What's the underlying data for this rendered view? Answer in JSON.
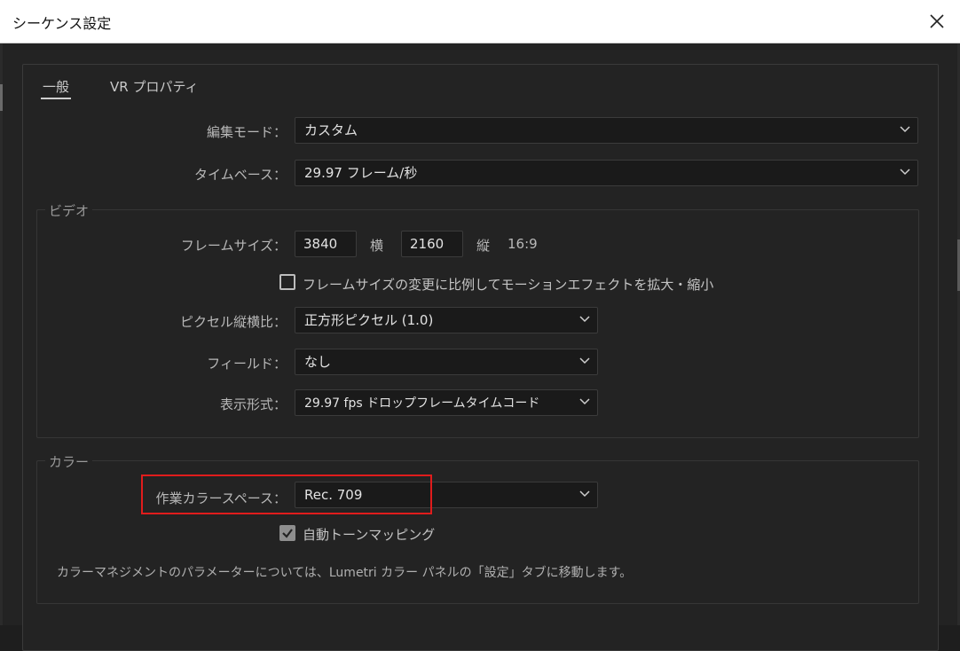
{
  "window": {
    "title": "シーケンス設定"
  },
  "tabs": [
    {
      "label": "一般",
      "active": true
    },
    {
      "label": "VR プロパティ",
      "active": false
    }
  ],
  "general": {
    "edit_mode": {
      "label": "編集モード：",
      "value": "カスタム"
    },
    "timebase": {
      "label": "タイムベース：",
      "value": "29.97  フレーム/秒"
    }
  },
  "video": {
    "title": "ビデオ",
    "frame_size": {
      "label": "フレームサイズ：",
      "width": "3840",
      "width_unit": "横",
      "height": "2160",
      "height_unit": "縦",
      "ratio": "16:9"
    },
    "scale_checkbox": {
      "label": "フレームサイズの変更に比例してモーションエフェクトを拡大・縮小",
      "checked": false
    },
    "pixel_aspect": {
      "label": "ピクセル縦横比：",
      "value": "正方形ピクセル (1.0)"
    },
    "fields": {
      "label": "フィールド：",
      "value": "なし"
    },
    "display_format": {
      "label": "表示形式：",
      "value": "29.97 fps ドロップフレームタイムコード"
    }
  },
  "color": {
    "title": "カラー",
    "working_space": {
      "label": "作業カラースペース：",
      "value": "Rec. 709"
    },
    "tone_mapping": {
      "label": "自動トーンマッピング",
      "checked": true
    },
    "note": "カラーマネジメントのパラメーターについては、Lumetri カラー パネルの「設定」タブに移動します。"
  },
  "colors": {
    "highlight": "#e01c1c",
    "background": "#232323",
    "field": "#1a1a1a"
  }
}
